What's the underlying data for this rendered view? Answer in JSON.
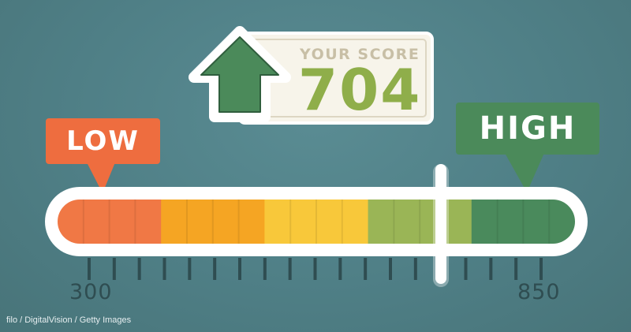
{
  "score": {
    "label": "YOUR SCORE",
    "value": "704",
    "numeric_value": 704,
    "trend_icon": "up-arrow-icon"
  },
  "scale": {
    "min_label": "300",
    "max_label": "850",
    "min": 300,
    "max": 850,
    "low_label": "LOW",
    "high_label": "HIGH",
    "segment_colors": [
      "#f07845",
      "#f5a523",
      "#f8c83a",
      "#9ab556",
      "#4a8a5c"
    ],
    "marker_value": 704
  },
  "colors": {
    "background": "#4f7f86",
    "score_value": "#8fae4a",
    "score_label": "#c8bfa6",
    "low_badge": "#ee6d3f",
    "high_badge": "#4b8a5a",
    "arrow": "#4b8a5a"
  },
  "credit": "filo / DigitalVision / Getty Images"
}
